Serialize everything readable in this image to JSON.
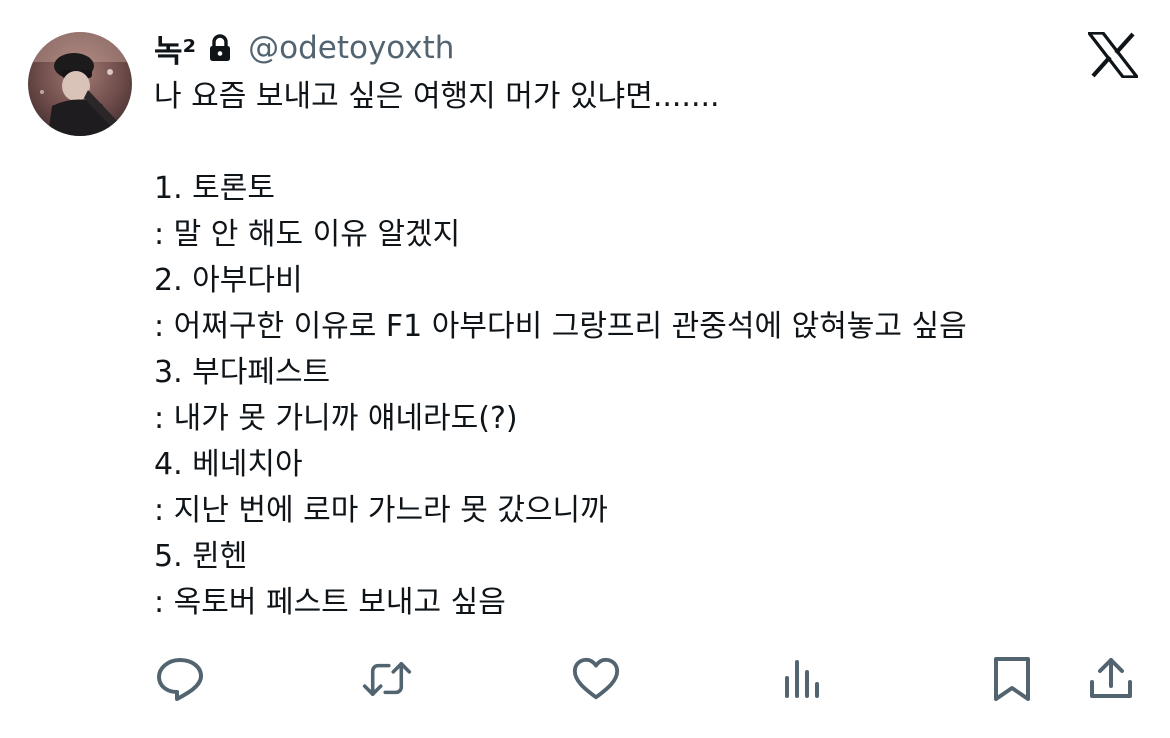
{
  "tweet": {
    "display_name": "녹²",
    "handle": "@odetoyoxth",
    "protected_icon": "lock-icon",
    "brand_icon": "x-logo-icon",
    "text_color": "#0f1419",
    "handle_color": "#536471",
    "lines": [
      "나 요즘 보내고 싶은 여행지 머가 있냐면.......",
      "",
      "1. 토론토",
      ": 말 안 해도 이유 알겠지",
      "2. 아부다비",
      ": 어쩌구한 이유로 F1 아부다비 그랑프리 관중석에 앉혀놓고 싶음",
      "3. 부다페스트",
      ": 내가 못 가니까 얘네라도(?)",
      "4. 베네치아",
      ": 지난 번에 로마 가느라 못 갔으니까",
      "5. 뮌헨",
      ": 옥토버 페스트 보내고 싶음"
    ]
  },
  "actions": [
    {
      "name": "reply",
      "icon": "reply-icon"
    },
    {
      "name": "retweet",
      "icon": "retweet-icon"
    },
    {
      "name": "like",
      "icon": "heart-icon"
    },
    {
      "name": "views",
      "icon": "views-icon"
    },
    {
      "name": "bookmark",
      "icon": "bookmark-icon"
    },
    {
      "name": "share",
      "icon": "share-icon"
    }
  ],
  "action_icon_color": "#536471"
}
